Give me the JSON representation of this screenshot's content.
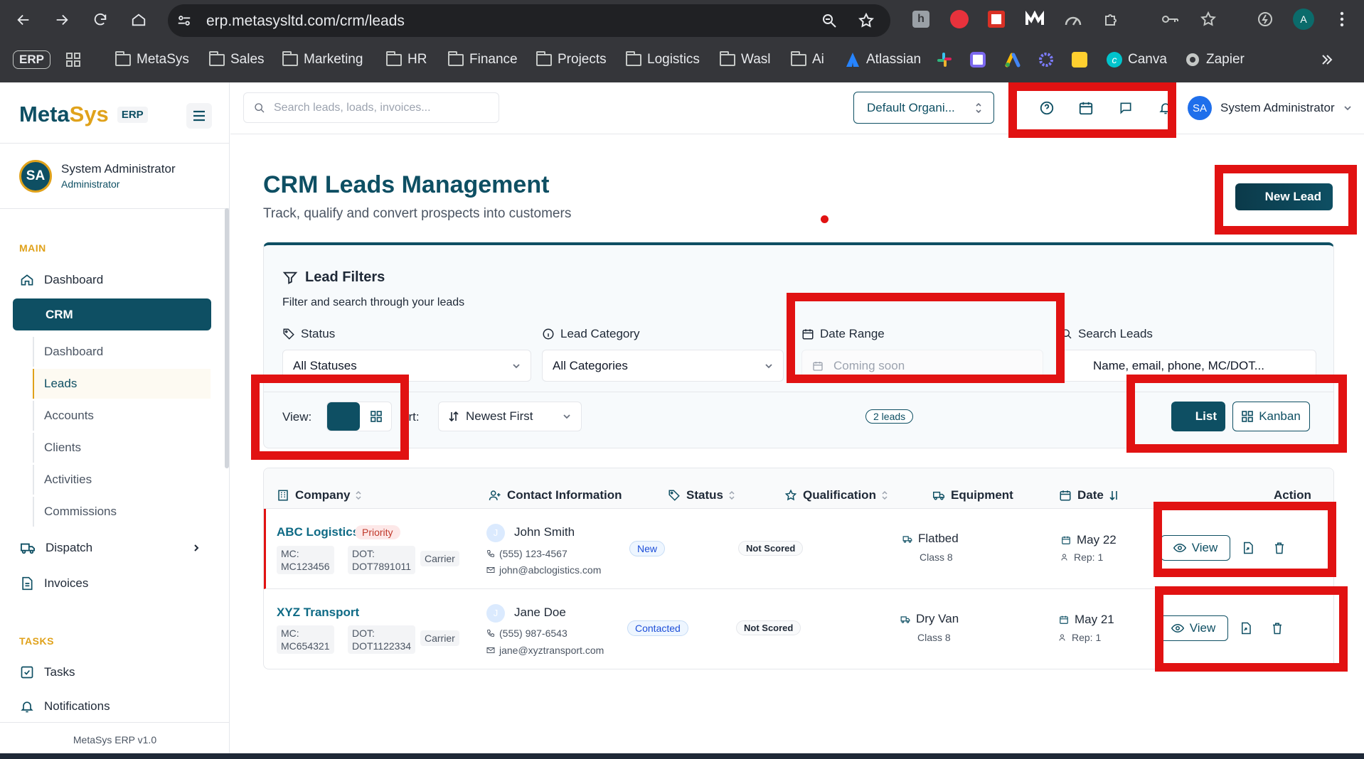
{
  "browser": {
    "url": "erp.metasysltd.com/crm/leads",
    "bookmarks": [
      "MetaSys",
      "Sales",
      "Marketing",
      "HR",
      "Finance",
      "Projects",
      "Logistics",
      "Wasl",
      "Ai"
    ],
    "bookmark_apps": [
      "Atlassian",
      "Canva",
      "Zapier"
    ],
    "erp_badge": "ERP",
    "profile_initial": "A"
  },
  "sidebar": {
    "logo_meta": "Meta",
    "logo_sys": "Sys",
    "logo_badge": "ERP",
    "user_initials": "SA",
    "user_name": "System Administrator",
    "user_role": "Administrator",
    "main_label": "MAIN",
    "dashboard": "Dashboard",
    "crm": "CRM",
    "crm_items": [
      "Dashboard",
      "Leads",
      "Accounts",
      "Clients",
      "Activities",
      "Commissions"
    ],
    "dispatch": "Dispatch",
    "invoices": "Invoices",
    "tasks_label": "TASKS",
    "tasks": "Tasks",
    "notifications": "Notifications",
    "version": "MetaSys ERP v1.0"
  },
  "topbar": {
    "search_placeholder": "Search leads, loads, invoices...",
    "org": "Default Organi...",
    "user_initials": "SA",
    "user_name": "System Administrator"
  },
  "page": {
    "title": "CRM Leads Management",
    "subtitle": "Track, qualify and convert prospects into customers",
    "new_lead": "New Lead"
  },
  "filters": {
    "title": "Lead Filters",
    "subtitle": "Filter and search through your leads",
    "status_label": "Status",
    "status_value": "All Statuses",
    "category_label": "Lead Category",
    "category_value": "All Categories",
    "date_label": "Date Range",
    "date_placeholder": "Coming soon",
    "search_label": "Search Leads",
    "search_placeholder": "Name, email, phone, MC/DOT...",
    "view_label": "View:",
    "sort_label": "ort:",
    "sort_value": "Newest First",
    "count": "2 leads",
    "list": "List",
    "kanban": "Kanban"
  },
  "table": {
    "headers": {
      "company": "Company",
      "contact": "Contact Information",
      "status": "Status",
      "qualification": "Qualification",
      "equipment": "Equipment",
      "date": "Date",
      "action": "Action"
    },
    "rows": [
      {
        "company": "ABC Logistics",
        "priority": "Priority",
        "mc_label": "MC:",
        "mc": "MC123456",
        "dot_label": "DOT:",
        "dot": "DOT7891011",
        "type": "Carrier",
        "avatar": "J",
        "contact": "John Smith",
        "phone": "(555) 123-4567",
        "email": "john@abclogistics.com",
        "status": "New",
        "qualification": "Not Scored",
        "equipment": "Flatbed",
        "equip_class": "Class 8",
        "date": "May 22",
        "rep": "Rep: 1",
        "view": "View"
      },
      {
        "company": "XYZ Transport",
        "priority": "",
        "mc_label": "MC:",
        "mc": "MC654321",
        "dot_label": "DOT:",
        "dot": "DOT1122334",
        "type": "Carrier",
        "avatar": "J",
        "contact": "Jane Doe",
        "phone": "(555) 987-6543",
        "email": "jane@xyztransport.com",
        "status": "Contacted",
        "qualification": "Not Scored",
        "equipment": "Dry Van",
        "equip_class": "Class 8",
        "date": "May 21",
        "rep": "Rep: 1",
        "view": "View"
      }
    ]
  },
  "colors": {
    "primary": "#0e4f63",
    "accent": "#e0a21b",
    "highlight": "#e11212",
    "chrome": "#35363a"
  }
}
